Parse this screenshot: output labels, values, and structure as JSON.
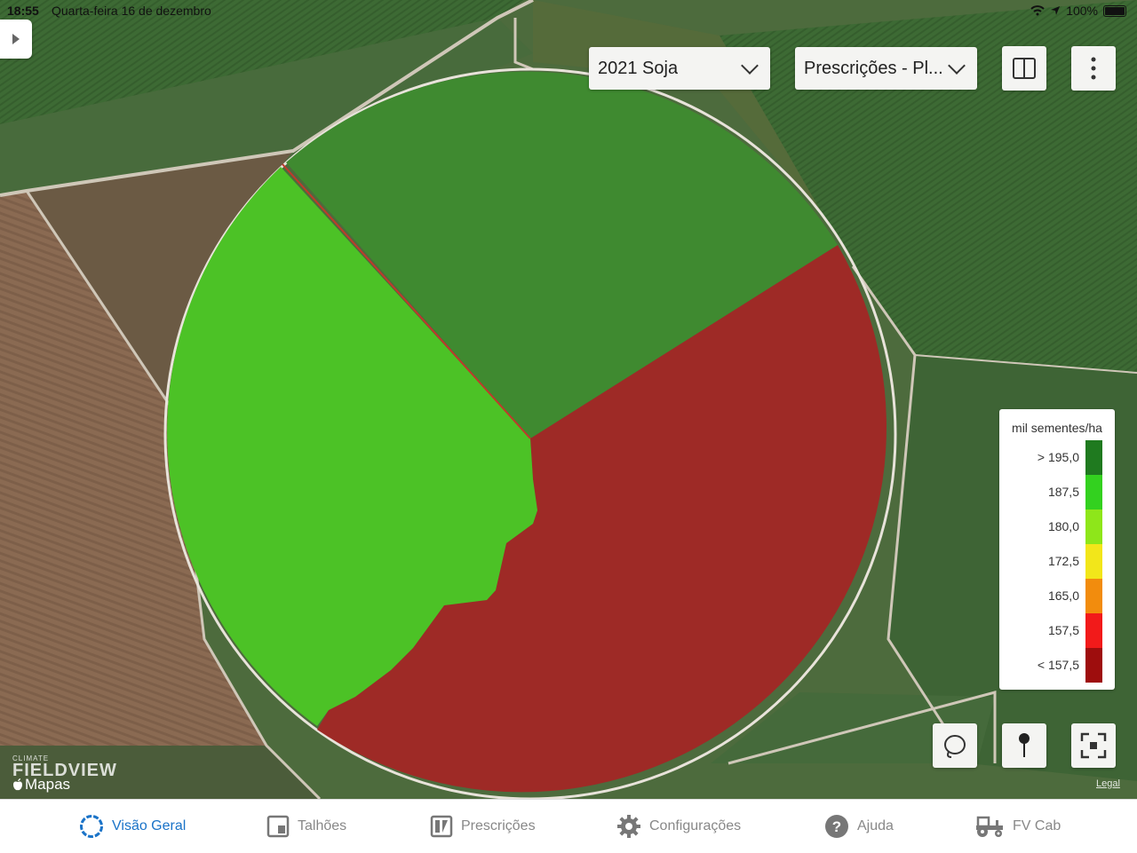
{
  "status_bar": {
    "time": "18:55",
    "date": "Quarta-feira 16 de dezembro",
    "battery": "100%"
  },
  "toolbar": {
    "season_select": "2021 Soja",
    "layer_select": "Prescrições - Pl..."
  },
  "legend": {
    "title": "mil sementes/ha",
    "items": [
      {
        "label": "> 195,0",
        "color": "#1f7a1f"
      },
      {
        "label": "187,5",
        "color": "#33d11f"
      },
      {
        "label": "180,0",
        "color": "#8ee61a"
      },
      {
        "label": "172,5",
        "color": "#f2e61a"
      },
      {
        "label": "165,0",
        "color": "#f28c0d"
      },
      {
        "label": "157,5",
        "color": "#f21a1a"
      },
      {
        "label": "< 157,5",
        "color": "#9e0d0d"
      }
    ]
  },
  "field_zones": [
    {
      "zone": "top",
      "color": "#3f8a30"
    },
    {
      "zone": "left",
      "color": "#4cc226"
    },
    {
      "zone": "right",
      "color": "#9e2a26"
    }
  ],
  "map_branding": {
    "climate": "CLIMATE",
    "fieldview": "FIELDVIEW",
    "maps": "Mapas",
    "legal": "Legal"
  },
  "tab_bar": [
    {
      "label": "Visão Geral",
      "active": true
    },
    {
      "label": "Talhões"
    },
    {
      "label": "Prescrições"
    },
    {
      "label": "Configurações"
    },
    {
      "label": "Ajuda"
    },
    {
      "label": "FV Cab"
    }
  ],
  "colors": {
    "accent": "#1a73c8",
    "inactive": "#888888"
  }
}
